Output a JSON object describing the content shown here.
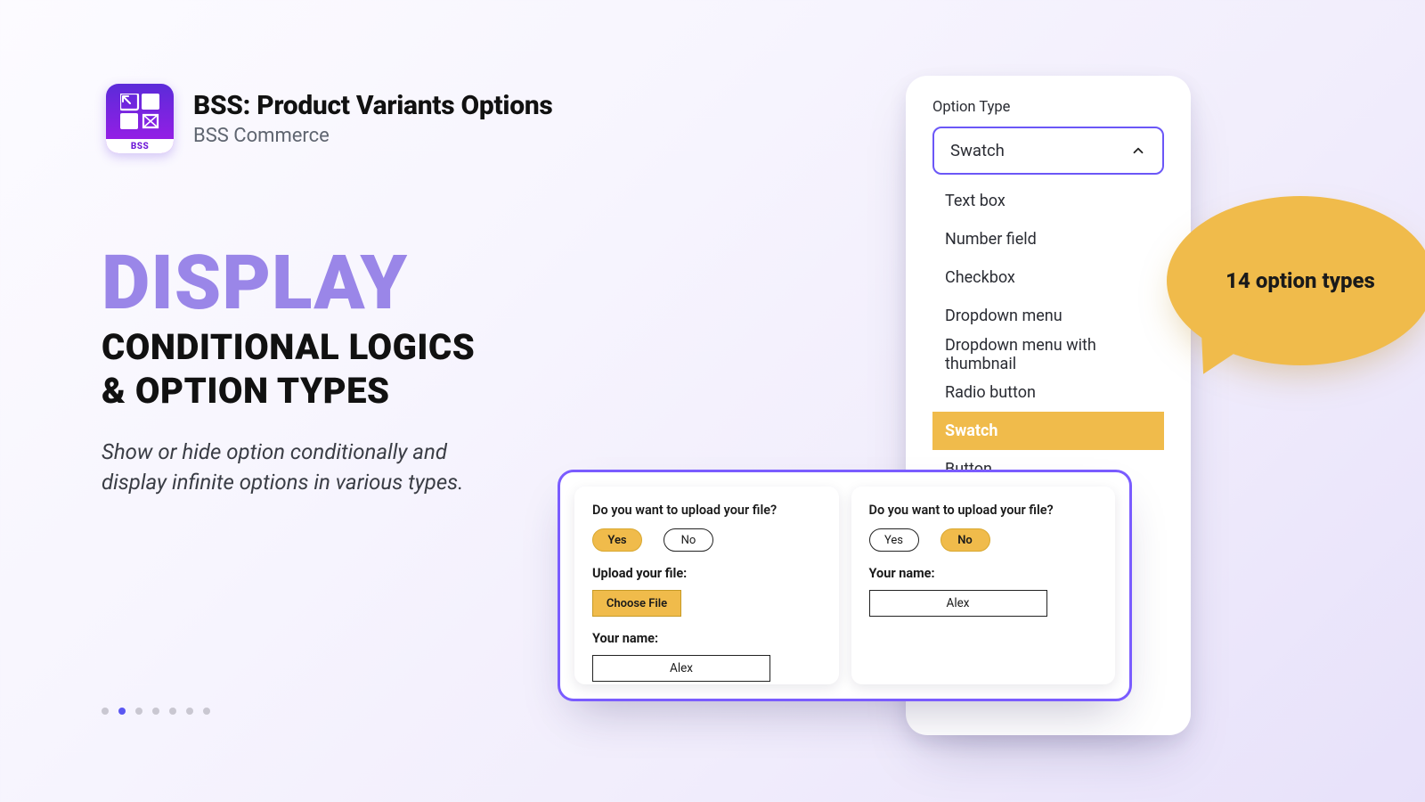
{
  "brand": {
    "logo_footer": "BSS",
    "title": "BSS: Product Variants Options",
    "subtitle": "BSS Commerce"
  },
  "hero": {
    "display": "DISPLAY",
    "sub1": "CONDITIONAL LOGICS",
    "sub2": " & OPTION TYPES",
    "desc": "Show or hide option conditionally and display infinite options in various types."
  },
  "callout": {
    "text": "14 option types"
  },
  "dropdown": {
    "label": "Option Type",
    "selected": "Swatch",
    "items": [
      "Text box",
      "Number field",
      "Checkbox",
      "Dropdown menu",
      "Dropdown menu with thumbnail",
      "Radio button",
      "Swatch",
      "Button"
    ]
  },
  "cond": {
    "question": "Do you want to upload your file?",
    "yes": "Yes",
    "no": "No",
    "upload_label": "Upload your file:",
    "choose": "Choose File",
    "name_label": "Your name:",
    "name_value": "Alex"
  },
  "pagination": {
    "count": 7,
    "active_index": 1
  }
}
